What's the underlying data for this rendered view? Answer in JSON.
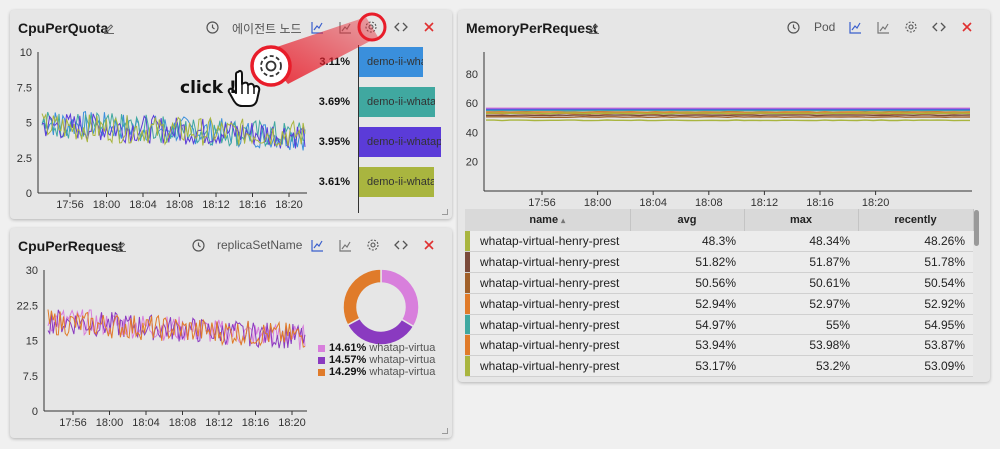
{
  "panels": {
    "quota": {
      "title": "CpuPerQuota",
      "filter_label": "에이전트 노드",
      "y_ticks": [
        "10",
        "7.5",
        "5",
        "2.5",
        "0"
      ],
      "x_ticks": [
        "17:56",
        "18:00",
        "18:04",
        "18:08",
        "18:12",
        "18:16",
        "18:20"
      ],
      "bars": [
        {
          "pct": "3.11%",
          "label": "demo-ii-whatap",
          "color": "#3a8fdc",
          "fill": 0.78
        },
        {
          "pct": "3.69%",
          "label": "demo-ii-whatap",
          "color": "#40a8a0",
          "fill": 0.93
        },
        {
          "pct": "3.95%",
          "label": "demo-ii-whatap",
          "color": "#5b3bd8",
          "fill": 1.0
        },
        {
          "pct": "3.61%",
          "label": "demo-ii-whatap",
          "color": "#a9b53f",
          "fill": 0.91
        }
      ]
    },
    "request": {
      "title": "CpuPerRequest",
      "filter_label": "replicaSetName",
      "y_ticks": [
        "30",
        "22.5",
        "15",
        "7.5",
        "0"
      ],
      "x_ticks": [
        "17:56",
        "18:00",
        "18:04",
        "18:08",
        "18:12",
        "18:16",
        "18:20"
      ],
      "legend": [
        {
          "pct": "14.61%",
          "name": "whatap-virtua",
          "color": "#d87fdc"
        },
        {
          "pct": "14.57%",
          "name": "whatap-virtua",
          "color": "#8a3ac0"
        },
        {
          "pct": "14.29%",
          "name": "whatap-virtua",
          "color": "#e07b2a"
        }
      ]
    },
    "memory": {
      "title": "MemoryPerRequest",
      "filter_label": "Pod",
      "y_ticks": [
        "80",
        "60",
        "40",
        "20"
      ],
      "x_ticks": [
        "17:56",
        "18:00",
        "18:04",
        "18:08",
        "18:12",
        "18:16",
        "18:20"
      ],
      "table": {
        "headers": [
          "name",
          "avg",
          "max",
          "recently"
        ],
        "rows": [
          {
            "name": "whatap-virtual-henry-prest",
            "avg": "48.3%",
            "max": "48.34%",
            "recently": "48.26%",
            "color": "#a9b53f"
          },
          {
            "name": "whatap-virtual-henry-prest",
            "avg": "51.82%",
            "max": "51.87%",
            "recently": "51.78%",
            "color": "#7a4a3a"
          },
          {
            "name": "whatap-virtual-henry-prest",
            "avg": "50.56%",
            "max": "50.61%",
            "recently": "50.54%",
            "color": "#a0602a"
          },
          {
            "name": "whatap-virtual-henry-prest",
            "avg": "52.94%",
            "max": "52.97%",
            "recently": "52.92%",
            "color": "#e07b2a"
          },
          {
            "name": "whatap-virtual-henry-prest",
            "avg": "54.97%",
            "max": "55%",
            "recently": "54.95%",
            "color": "#40a8a0"
          },
          {
            "name": "whatap-virtual-henry-prest",
            "avg": "53.94%",
            "max": "53.98%",
            "recently": "53.87%",
            "color": "#e07b2a"
          },
          {
            "name": "whatap-virtual-henry-prest",
            "avg": "53.17%",
            "max": "53.2%",
            "recently": "53.09%",
            "color": "#a9b53f"
          }
        ]
      }
    }
  },
  "annotation": {
    "text": "click !"
  },
  "colors": {
    "accent_blue": "#3a5fcd",
    "close_red": "#e03030",
    "callout_red": "#e81d2a"
  }
}
